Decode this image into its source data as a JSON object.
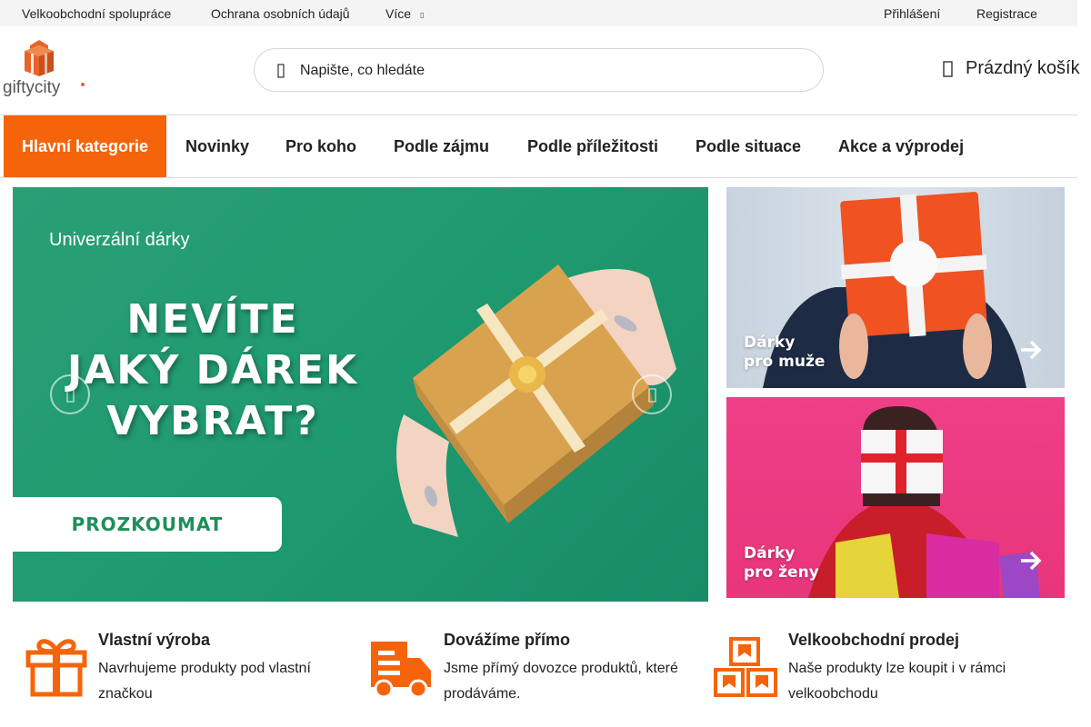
{
  "topbar": {
    "wholesale": "Velkoobchodní spolupráce",
    "privacy": "Ochrana osobních údajů",
    "more": "Více",
    "login": "Přihlášení",
    "register": "Registrace"
  },
  "logo": {
    "text": "giftycity"
  },
  "search": {
    "placeholder": "Napište, co hledáte"
  },
  "cart": {
    "label": "Prázdný košík"
  },
  "nav": {
    "items": [
      {
        "label": "Hlavní kategorie",
        "active": true
      },
      {
        "label": "Novinky"
      },
      {
        "label": "Pro koho"
      },
      {
        "label": "Podle zájmu"
      },
      {
        "label": "Podle příležitosti"
      },
      {
        "label": "Podle situace"
      },
      {
        "label": "Akce a výprodej"
      }
    ]
  },
  "hero": {
    "tag": "Univerzální dárky",
    "line1": "NEVÍTE",
    "line2": "JAKÝ DÁREK",
    "line3": "VYBRAT?",
    "cta": "PROZKOUMAT"
  },
  "banners": {
    "men": {
      "line1": "Dárky",
      "line2": "pro muže"
    },
    "women": {
      "line1": "Dárky",
      "line2": "pro ženy"
    }
  },
  "features": [
    {
      "title": "Vlastní výroba",
      "desc": "Navrhujeme produkty pod vlastní značkou",
      "icon": "gift-icon"
    },
    {
      "title": "Dovážíme přímo",
      "desc": "Jsme přímý dovozce produktů, které prodáváme.",
      "icon": "delivery-truck-icon"
    },
    {
      "title": "Velkoobchodní prodej",
      "desc": "Naše produkty lze koupit i v rámci velkoobchodu",
      "icon": "boxes-icon"
    }
  ],
  "colors": {
    "accent": "#f5640a",
    "hero_bg": "#1f9a70",
    "cta_text": "#1f8f5a",
    "women_bg": "#ec3a82"
  }
}
